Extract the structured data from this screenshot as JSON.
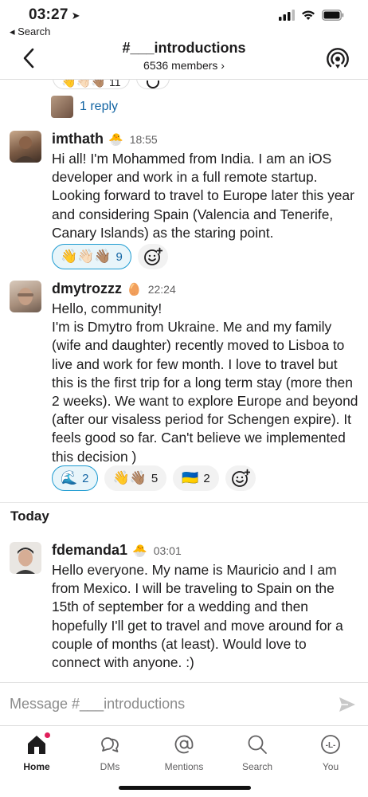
{
  "status_bar": {
    "time": "03:27",
    "back_app": "◂ Search"
  },
  "header": {
    "channel": "#___introductions",
    "members": "6536 members ›"
  },
  "previous_message": {
    "reply_label": "1 reply",
    "partial_reaction_count": "11"
  },
  "messages": [
    {
      "username": "imthath",
      "status_emoji": "🐣",
      "time": "18:55",
      "body": "Hi all! I'm Mohammed from India. I am an iOS developer and work in a full remote startup. Looking forward to travel to Europe later this year and considering Spain (Valencia and Tenerife, Canary Islands) as the staring point.",
      "reactions": [
        {
          "emoji": "👋👋🏻👋🏽",
          "count": "9",
          "mine": true
        }
      ]
    },
    {
      "username": "dmytrozzz",
      "status_emoji": "🥚",
      "time": "22:24",
      "body": "Hello, community!\nI'm is Dmytro from Ukraine. Me and my family (wife and daughter) recently moved to Lisboa to live and work for few month. I love to travel but this is the first trip for a long term stay (more then 2 weeks). We want to explore Europe and beyond (after our visaless period for Schengen expire). It feels good so far. Can't believe we implemented this decision )",
      "reactions": [
        {
          "emoji": "🌊",
          "count": "2",
          "mine": true
        },
        {
          "emoji": "👋👋🏽",
          "count": "5",
          "mine": false
        },
        {
          "emoji": "🇺🇦",
          "count": "2",
          "mine": false
        }
      ]
    }
  ],
  "day_divider": "Today",
  "today_message": {
    "username": "fdemanda1",
    "status_emoji": "🐣",
    "time": "03:01",
    "body": "Hello everyone. My name is Mauricio and I am from Mexico. I will be traveling to Spain on the 15th of september for a wedding and then hopefully I'll get to travel and move around for a couple of months (at least). Would love to connect with anyone. :)"
  },
  "composer": {
    "placeholder": "Message #___introductions"
  },
  "tabs": [
    {
      "label": "Home",
      "icon": "home-icon"
    },
    {
      "label": "DMs",
      "icon": "dms-icon"
    },
    {
      "label": "Mentions",
      "icon": "mentions-icon"
    },
    {
      "label": "Search",
      "icon": "search-icon"
    },
    {
      "label": "You",
      "icon": "you-icon"
    }
  ],
  "colors": {
    "link": "#1264a3",
    "reaction_mine_border": "#1d9bd1",
    "badge": "#e01e5a"
  }
}
